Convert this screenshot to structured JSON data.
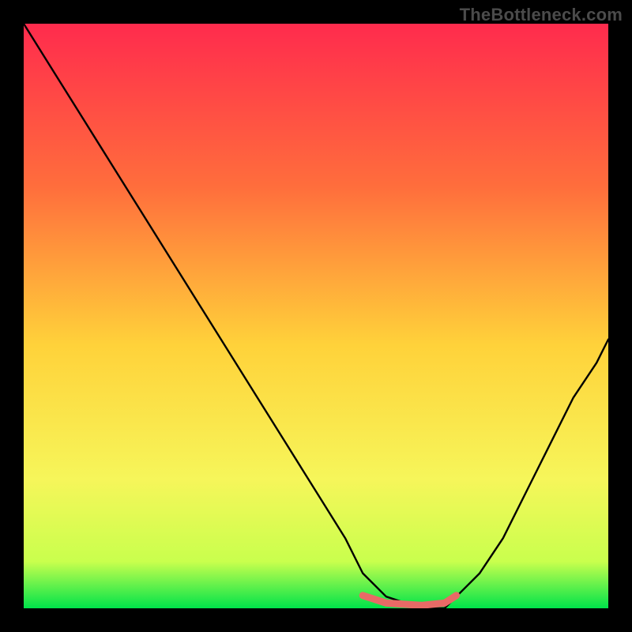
{
  "watermark": "TheBottleneck.com",
  "chart_data": {
    "type": "line",
    "title": "",
    "xlabel": "",
    "ylabel": "",
    "xlim": [
      0,
      100
    ],
    "ylim": [
      0,
      100
    ],
    "gradient_colors": {
      "top": "#ff2b4d",
      "upper_mid": "#ff6e3c",
      "mid": "#ffd23a",
      "lower_mid": "#f6f65a",
      "lower": "#c9ff4d",
      "bottom": "#00e34a"
    },
    "series": [
      {
        "name": "bottleneck-curve",
        "color": "#000000",
        "x": [
          0,
          5,
          10,
          15,
          20,
          25,
          30,
          35,
          40,
          45,
          50,
          55,
          58,
          62,
          68,
          72,
          74,
          78,
          82,
          86,
          90,
          94,
          98,
          100
        ],
        "y": [
          100,
          92,
          84,
          76,
          68,
          60,
          52,
          44,
          36,
          28,
          20,
          12,
          6,
          2,
          0,
          0,
          2,
          6,
          12,
          20,
          28,
          36,
          42,
          46
        ]
      }
    ],
    "highlight": {
      "name": "optimal-range",
      "color": "#e86a66",
      "x": [
        58,
        62,
        68,
        72,
        74
      ],
      "y": [
        2.2,
        0.9,
        0.5,
        0.9,
        2.2
      ]
    }
  }
}
